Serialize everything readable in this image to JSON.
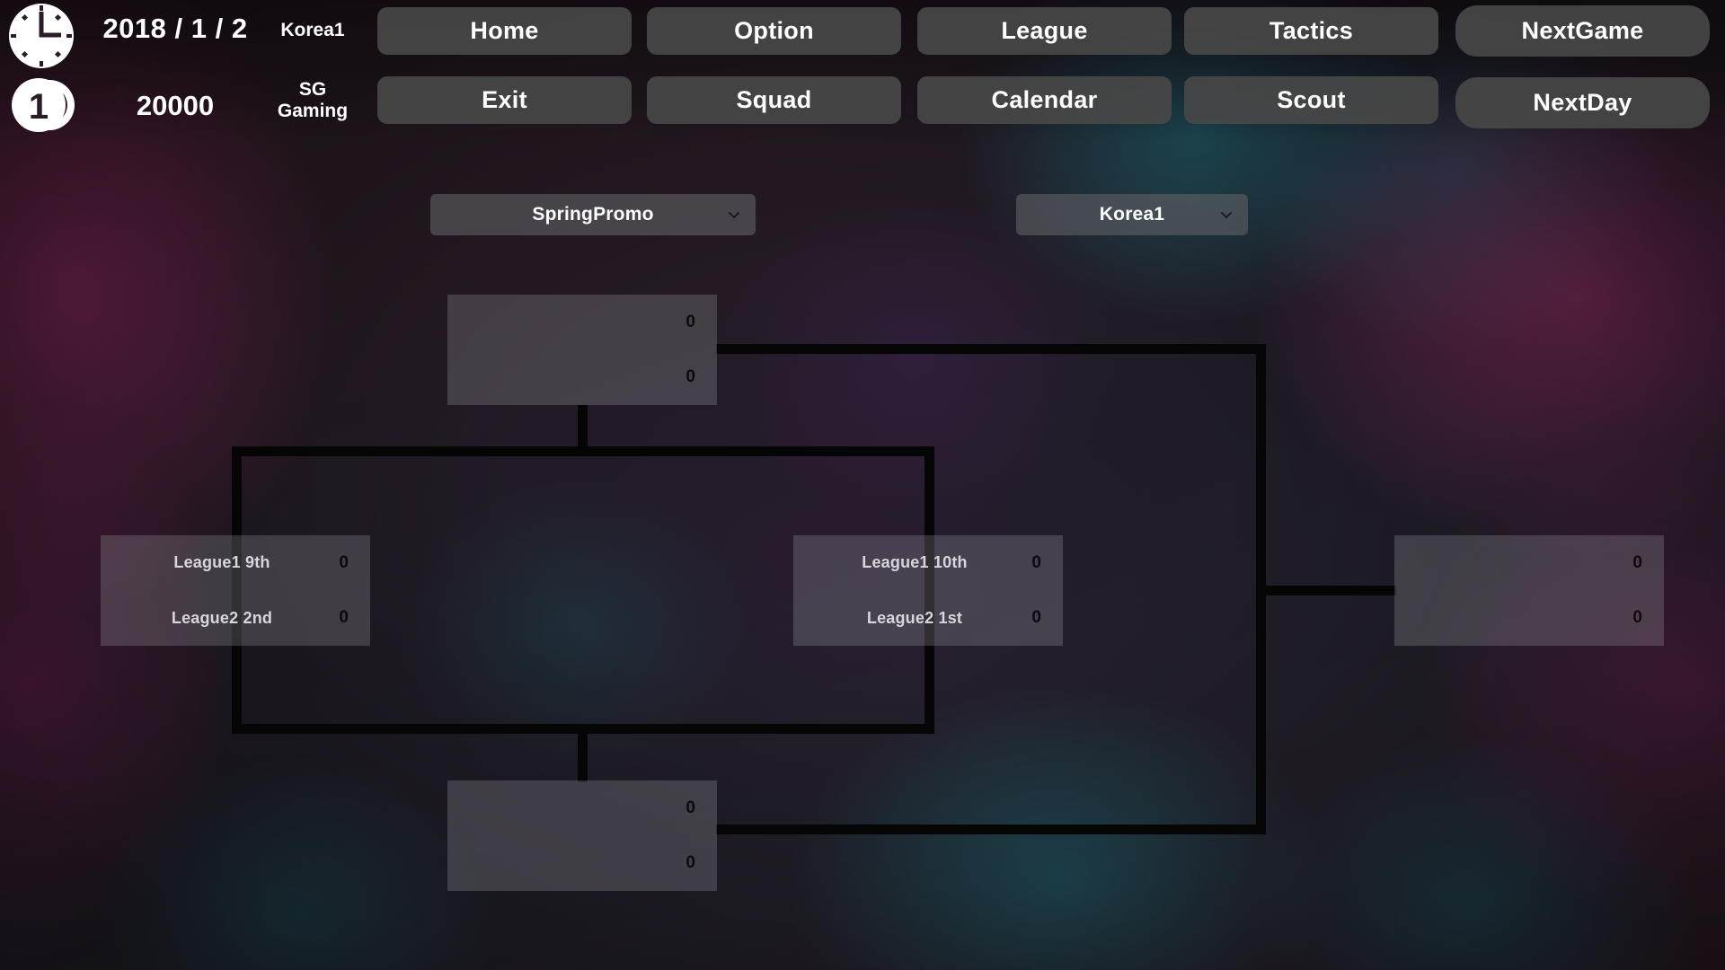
{
  "header": {
    "clock_icon": "clock-icon",
    "coin_icon": "coin-icon",
    "date": "2018 / 1 / 2",
    "money": "20000",
    "league": "Korea1",
    "team": "SG\nGaming",
    "team_line1": "SG",
    "team_line2": "Gaming",
    "nav": [
      {
        "label": "Home",
        "name": "home"
      },
      {
        "label": "Option",
        "name": "option"
      },
      {
        "label": "League",
        "name": "league"
      },
      {
        "label": "Tactics",
        "name": "tactics"
      },
      {
        "label": "NextGame",
        "name": "nextgame"
      },
      {
        "label": "Exit",
        "name": "exit"
      },
      {
        "label": "Squad",
        "name": "squad"
      },
      {
        "label": "Calendar",
        "name": "calendar"
      },
      {
        "label": "Scout",
        "name": "scout"
      },
      {
        "label": "NextDay",
        "name": "nextday"
      }
    ]
  },
  "filters": {
    "tournament": {
      "value": "SpringPromo",
      "caret_icon": "chevron-down-icon"
    },
    "region": {
      "value": "Korea1",
      "caret_icon": "chevron-down-icon"
    }
  },
  "bracket": {
    "title": "SpringPromo",
    "matches": {
      "top": {
        "name": "match-top",
        "team1": "",
        "score1": "0",
        "team2": "",
        "score2": "0"
      },
      "left": {
        "name": "match-left",
        "team1": "League1 9th",
        "score1": "0",
        "team2": "League2 2nd",
        "score2": "0"
      },
      "mid": {
        "name": "match-mid",
        "team1": "League1 10th",
        "score1": "0",
        "team2": "League2 1st",
        "score2": "0"
      },
      "right": {
        "name": "match-final",
        "team1": "",
        "score1": "0",
        "team2": "",
        "score2": "0"
      },
      "bottom": {
        "name": "match-bottom",
        "team1": "",
        "score1": "0",
        "team2": "",
        "score2": "0"
      }
    }
  },
  "colors": {
    "button_bg": "#484848",
    "line": "#050505",
    "match_box": "#aaaab2",
    "text_light": "#ffffff",
    "team_text": "#d8d6da",
    "score_text": "#0b0b0b"
  }
}
